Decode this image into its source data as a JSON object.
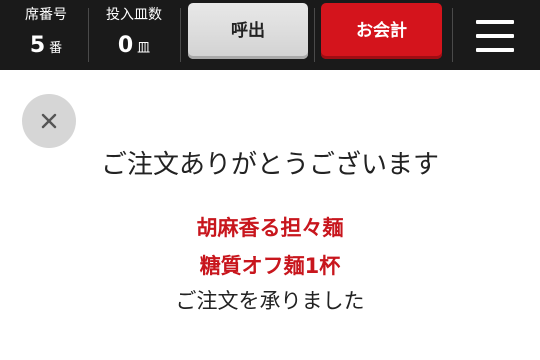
{
  "header": {
    "seat": {
      "label": "席番号",
      "value": "5",
      "unit": "番"
    },
    "plates": {
      "label": "投入皿数",
      "value": "0",
      "unit": "皿"
    },
    "call_button": "呼出",
    "checkout_button": "お会計",
    "menu_icon": "hamburger-menu-icon"
  },
  "dialog": {
    "close_icon": "close-icon",
    "thanks": "ご注文ありがとうございます",
    "item_name": "胡麻香る担々麺",
    "item_detail": "糖質オフ麺1杯",
    "received": "ご注文を承りました"
  },
  "colors": {
    "header_bg": "#1a1a1a",
    "checkout_red": "#d4141c",
    "item_red": "#c8161d",
    "close_circle": "#d6d6d6"
  }
}
